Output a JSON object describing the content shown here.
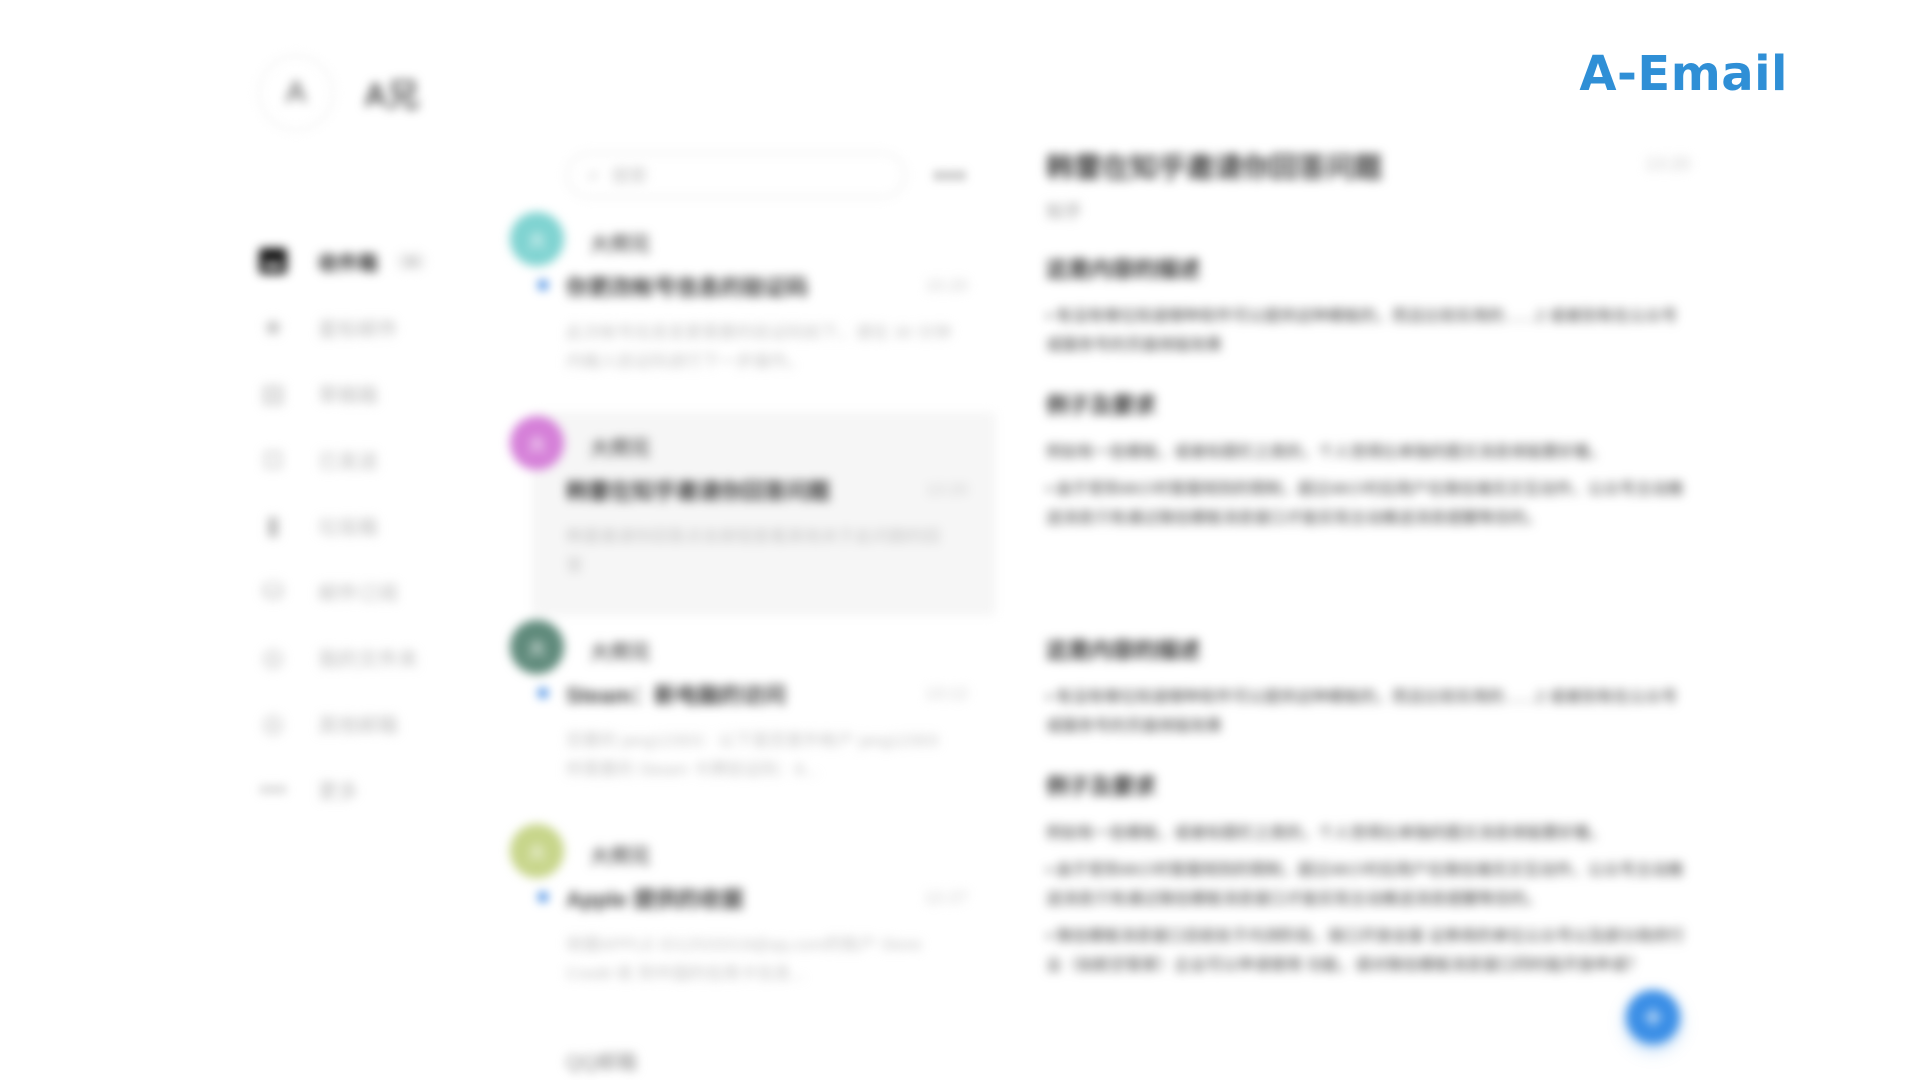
{
  "brand": {
    "title": "A-Email"
  },
  "profile": {
    "initial": "A",
    "name": "A兄"
  },
  "sidebar": {
    "items": [
      {
        "label": "收件箱",
        "icon": "inbox-icon",
        "count": "34",
        "active": true
      },
      {
        "label": "星标邮件",
        "icon": "star-icon"
      },
      {
        "label": "草稿箱",
        "icon": "draft-icon"
      },
      {
        "label": "已发送",
        "icon": "sent-icon"
      },
      {
        "label": "垃圾箱",
        "icon": "trash-icon"
      },
      {
        "label": "邮件订阅",
        "icon": "subscription-icon"
      },
      {
        "label": "我的文件夹",
        "icon": "folder-icon"
      },
      {
        "label": "其他邮箱",
        "icon": "mailbox-icon"
      },
      {
        "label": "更多",
        "icon": "more-icon"
      }
    ]
  },
  "search": {
    "placeholder": "搜索"
  },
  "mails": [
    {
      "initial": "大",
      "avatar_color": "#7fd3d1",
      "sender": "大师兄",
      "subject": "你更改帐号信息的验证码",
      "time": "15:20",
      "preview": "此次帐号信息变更需要的验证码如下，请在 30 分钟内输入验证码进行下一步操作。",
      "unread": true
    },
    {
      "initial": "大",
      "avatar_color": "#d57fd8",
      "sender": "大师兄",
      "subject": "韩雷在知乎邀请你回答问题",
      "time": "13:20",
      "preview": "韩雷邀请你回答点击按钮查看其他关于此问题的回答",
      "unread": false,
      "selected": true
    },
    {
      "initial": "大",
      "avatar_color": "#5f8a7b",
      "sender": "大师兄",
      "subject": "Steam：新电脑的访问",
      "time": "13:12",
      "preview": "您要的 jang12303：以下是您意外帐户 jang12303 所需要的 Steam 卡牌验证码：8...",
      "unread": true
    },
    {
      "initial": "大",
      "avatar_color": "#c7d58a",
      "sender": "大师兄",
      "subject": "Apple 提供的收据",
      "time": "12-27",
      "preview": "收据APPLE ID12533319@qq.com的账户 Store Credit 收 到中国的信用卡信息...",
      "unread": true
    }
  ],
  "qq_label": "QQ邮箱",
  "reader": {
    "title": "韩雷在知乎邀请你回答问题",
    "time": "13:20",
    "from": "知乎",
    "sections": [
      {
        "heading": "这是内容的描述",
        "lines": [
          "• 有没有哪位知道哪种软件可以提供这种模板的，而且比较实用的……2 或者别有在公众号或服务号的页面排版效果"
        ]
      },
      {
        "heading": "例子及要求",
        "lines": [
          "例如有一些模板，或者标题栏之类的，个人觉得比单独的图文消息排版要好看。",
          "• 由于受到48小时客服规则的限制，超过48小时后用户在微信端无交互动作，公众号主动推送消息只有通过微信模板消息窗口才能实现主动推送消息提醒等目的。"
        ]
      },
      {
        "heading": "这是内容的描述",
        "lines": [
          "• 有没有哪位知道哪种软件可以提供这种模板的，而且比较实用的……2 或者别有在公众号或服务号的页面排版效果"
        ]
      },
      {
        "heading": "例子及要求",
        "lines": [
          "例如有一些模板，或者标题栏之类的，个人觉得比单独的图文消息排版要好看。",
          "• 由于受到48小时客服规则的限制，超过48小时后用户在微信端无交互动作，公众号主动推送消息只有通过微信模板消息窗口才能实现主动推送消息提醒等目的。",
          "• 微信模板消息窗口目前处于内测阶段，接口开放全面 证券商的单位公众号以及部分政府行业（如航空管家）企业可以申请使用 功能，请对微信模板消息窗口同时能开放申请？"
        ]
      }
    ]
  },
  "fab": {
    "label": "+"
  },
  "colors": {
    "brand": "#2f8fd6",
    "unread": "#2f7fe0",
    "fab": "#3a8ee6"
  }
}
